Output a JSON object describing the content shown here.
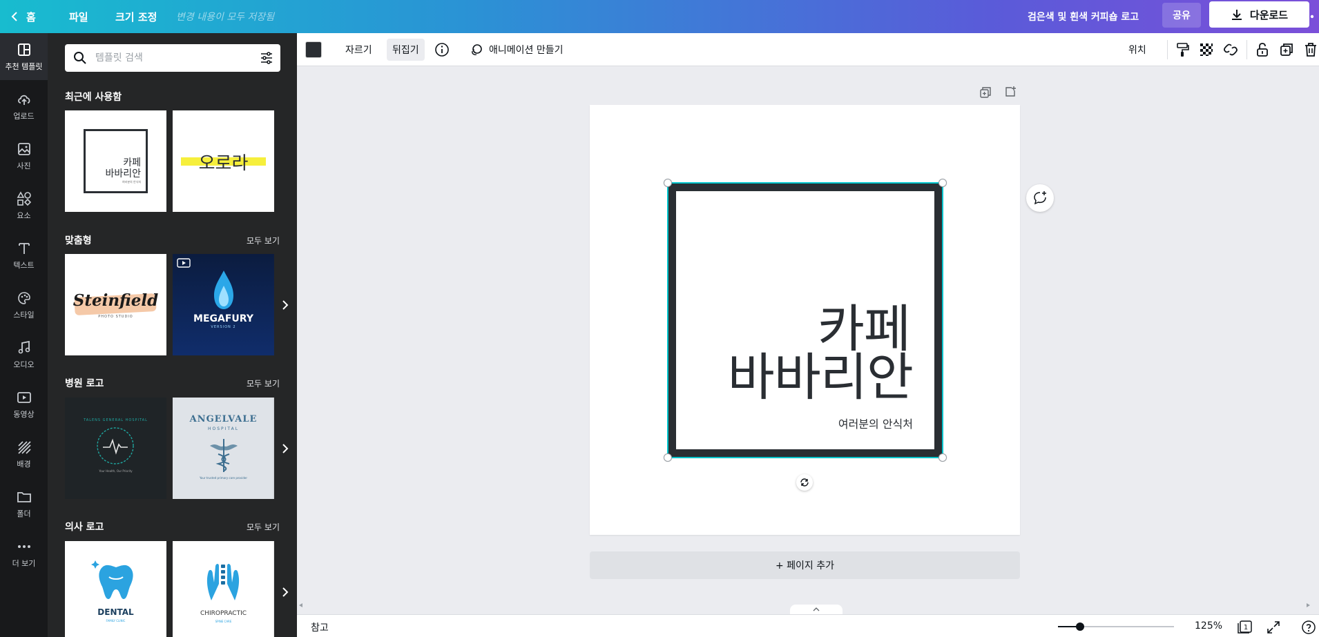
{
  "topbar": {
    "home_label": "홈",
    "file_label": "파일",
    "resize_label": "크기 조정",
    "save_status": "변경 내용이 모두 저장됨",
    "doc_title": "검은색 및 흰색 커피숍 로고",
    "share_label": "공유",
    "download_label": "다운로드"
  },
  "rail": {
    "items": [
      {
        "label": "추천 템플릿",
        "icon": "template-icon"
      },
      {
        "label": "업로드",
        "icon": "upload-icon"
      },
      {
        "label": "사진",
        "icon": "photo-icon"
      },
      {
        "label": "요소",
        "icon": "elements-icon"
      },
      {
        "label": "텍스트",
        "icon": "text-icon"
      },
      {
        "label": "스타일",
        "icon": "palette-icon"
      },
      {
        "label": "오디오",
        "icon": "audio-icon"
      },
      {
        "label": "동영상",
        "icon": "video-icon"
      },
      {
        "label": "배경",
        "icon": "background-icon"
      },
      {
        "label": "폴더",
        "icon": "folder-icon"
      },
      {
        "label": "더 보기",
        "icon": "more-icon"
      }
    ]
  },
  "panel": {
    "search_placeholder": "템플릿 검색",
    "see_all": "모두 보기",
    "sections": [
      {
        "title": "최근에 사용함"
      },
      {
        "title": "맞춤형"
      },
      {
        "title": "병원 로고"
      },
      {
        "title": "의사 로고"
      }
    ],
    "thumbs": {
      "recent1": {
        "line1": "카페",
        "line2": "바바리안",
        "sub": "여러분의 안식처"
      },
      "recent2": {
        "text": "오로라"
      },
      "custom1": {
        "text": "Steinfield",
        "sub": "PHOTO STUDIO"
      },
      "custom2": {
        "text": "MEGAFURY",
        "sub": "VERSION 2"
      },
      "hosp1": {
        "text": "TALENS GENERAL HOSPITAL",
        "sub": "Your Health, Our Priority"
      },
      "hosp2": {
        "text": "ANGELVALE",
        "sub": "HOSPITAL",
        "caption": "Your trusted primary care provider"
      },
      "doc1": {
        "text": "DENTAL",
        "sub": "FAMILY CLINIC"
      },
      "doc2": {
        "text": "CHIROPRACTIC",
        "sub": "SPINE CARE"
      }
    }
  },
  "toolbar": {
    "color": "#2a2e33",
    "crop_label": "자르기",
    "flip_label": "뒤집기",
    "animate_label": "애니메이션 만들기",
    "position_label": "위치"
  },
  "canvas": {
    "logo_line1": "카페",
    "logo_line2": "바바리안",
    "logo_sub": "여러분의 안식처",
    "add_page_label": "+ 페이지 추가",
    "accent_color": "#00c4cc"
  },
  "bottombar": {
    "notes_label": "참고",
    "zoom_label": "125%",
    "zoom_fraction": 0.19,
    "page_count": "1"
  }
}
